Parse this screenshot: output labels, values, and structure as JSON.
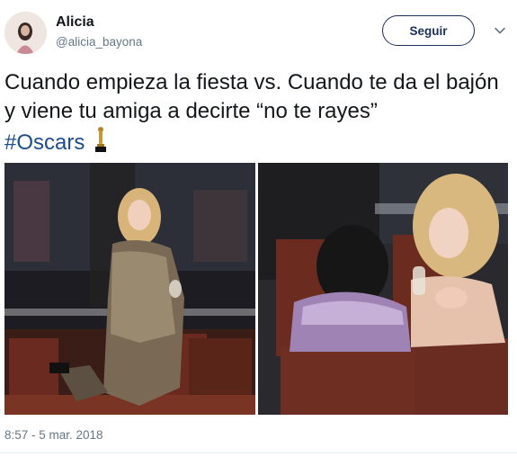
{
  "tweet": {
    "user_name": "Alicia",
    "user_handle": "@alicia_bayona",
    "follow_label": "Seguir",
    "text": "Cuando empieza la fiesta vs. Cuando te da el bajón y viene tu amiga a decirte “no te rayes”",
    "hashtag": "#Oscars",
    "timestamp": "8:57 - 5 mar. 2018"
  },
  "icons": {
    "menu": "chevron-down-icon",
    "emoji": "trophy-icon"
  },
  "colors": {
    "accent": "#1b2f5c",
    "hashtag": "#1b4d8c",
    "secondary_text": "#657786"
  }
}
